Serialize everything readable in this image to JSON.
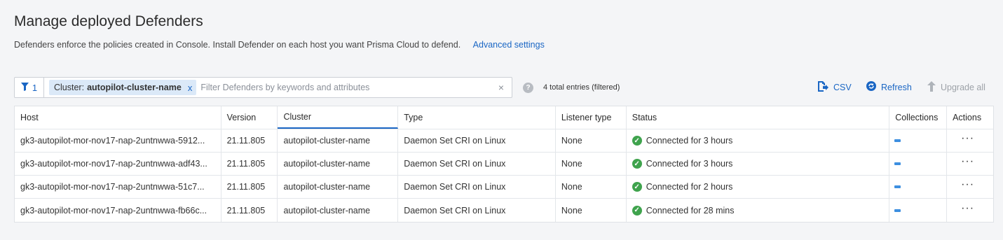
{
  "page": {
    "title": "Manage deployed Defenders",
    "subtitle": "Defenders enforce the policies created in Console. Install Defender on each host you want Prisma Cloud to defend.",
    "advanced_link": "Advanced settings"
  },
  "filter": {
    "count": "1",
    "chip_key": "Cluster:",
    "chip_value": "autopilot-cluster-name",
    "chip_remove": "x",
    "placeholder": "Filter Defenders by keywords and attributes",
    "clear": "×"
  },
  "summary": {
    "help": "?",
    "total": "4 total entries (filtered)"
  },
  "toolbar": {
    "csv": "CSV",
    "refresh": "Refresh",
    "upgrade_all": "Upgrade all"
  },
  "table": {
    "headers": {
      "host": "Host",
      "version": "Version",
      "cluster": "Cluster",
      "type": "Type",
      "listener": "Listener type",
      "status": "Status",
      "collections": "Collections",
      "actions": "Actions"
    },
    "rows": [
      {
        "host": "gk3-autopilot-mor-nov17-nap-2untnwwa-5912...",
        "version": "21.11.805",
        "cluster": "autopilot-cluster-name",
        "type": "Daemon Set CRI on Linux",
        "listener": "None",
        "status": "Connected for 3 hours",
        "actions": "···"
      },
      {
        "host": "gk3-autopilot-mor-nov17-nap-2untnwwa-adf43...",
        "version": "21.11.805",
        "cluster": "autopilot-cluster-name",
        "type": "Daemon Set CRI on Linux",
        "listener": "None",
        "status": "Connected for 3 hours",
        "actions": "···"
      },
      {
        "host": "gk3-autopilot-mor-nov17-nap-2untnwwa-51c7...",
        "version": "21.11.805",
        "cluster": "autopilot-cluster-name",
        "type": "Daemon Set CRI on Linux",
        "listener": "None",
        "status": "Connected for 2 hours",
        "actions": "···"
      },
      {
        "host": "gk3-autopilot-mor-nov17-nap-2untnwwa-fb66c...",
        "version": "21.11.805",
        "cluster": "autopilot-cluster-name",
        "type": "Daemon Set CRI on Linux",
        "listener": "None",
        "status": "Connected for 28 mins",
        "actions": "···"
      }
    ]
  },
  "icons": {
    "filter": "funnel-icon",
    "csv": "export-icon",
    "refresh": "refresh-icon",
    "upgrade": "arrow-up-icon",
    "status": "check-circle-icon"
  },
  "colors": {
    "accent": "#1a66c4",
    "success": "#3fa34d",
    "chip_bg": "#dbe9f8",
    "page_bg": "#f4f5f7"
  }
}
